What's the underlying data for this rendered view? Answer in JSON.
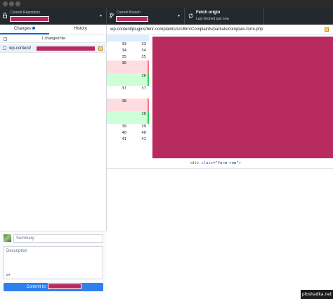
{
  "toolbar": {
    "repo": {
      "label": "Current Repository",
      "icon": "lock-icon",
      "chevron": "▾"
    },
    "branch": {
      "label": "Current Branch",
      "icon": "branch-icon",
      "chevron": "▾"
    },
    "fetch": {
      "title": "Fetch origin",
      "subtitle": "Last fetched just now",
      "icon": "sync-icon"
    }
  },
  "sidebar": {
    "tabs": [
      {
        "label": "Changes",
        "active": true,
        "has_dot": true
      },
      {
        "label": "History",
        "active": false
      }
    ],
    "changed_count_label": "1 changed file",
    "files": [
      {
        "path_prefix": "wp-content/",
        "status": "modified",
        "checked": true
      }
    ]
  },
  "commit": {
    "summary_placeholder": "Summary",
    "description_placeholder": "Description",
    "coauthor_glyph": "a+",
    "button_label": "Commit to"
  },
  "diff": {
    "file_path_prefix": "wp-content/plugins/bmr-complaints/src/BmrComplaints/partials/",
    "file_name": "complain-form.php",
    "rows": [
      {
        "old": "33",
        "new": "33",
        "type": "context"
      },
      {
        "old": "34",
        "new": "34",
        "type": "context"
      },
      {
        "old": "35",
        "new": "35",
        "type": "context"
      },
      {
        "old": "36",
        "new": "",
        "type": "del"
      },
      {
        "old": "",
        "new": "",
        "type": "del"
      },
      {
        "old": "",
        "new": "36",
        "type": "add"
      },
      {
        "old": "",
        "new": "",
        "type": "add"
      },
      {
        "old": "37",
        "new": "37",
        "type": "context"
      },
      {
        "old": "",
        "new": "",
        "type": "context"
      },
      {
        "old": "38",
        "new": "",
        "type": "del"
      },
      {
        "old": "",
        "new": "",
        "type": "del"
      },
      {
        "old": "",
        "new": "38",
        "type": "add"
      },
      {
        "old": "",
        "new": "",
        "type": "add"
      },
      {
        "old": "39",
        "new": "39",
        "type": "context"
      },
      {
        "old": "40",
        "new": "40",
        "type": "context"
      },
      {
        "old": "41",
        "new": "41",
        "type": "context"
      }
    ],
    "code_visible": {
      "open": "<div ",
      "attr": "class",
      "eq": "=",
      "value": "\"form-row\"",
      "close": ">"
    }
  },
  "watermark": "ploshadka.net",
  "colors": {
    "toolbar_bg": "#24292e",
    "accent": "#0366d6",
    "commit_button": "#2f80ed",
    "redaction": "#b72b5f",
    "deleted_bg": "#ffdce0",
    "added_bg": "#cdffd8"
  }
}
